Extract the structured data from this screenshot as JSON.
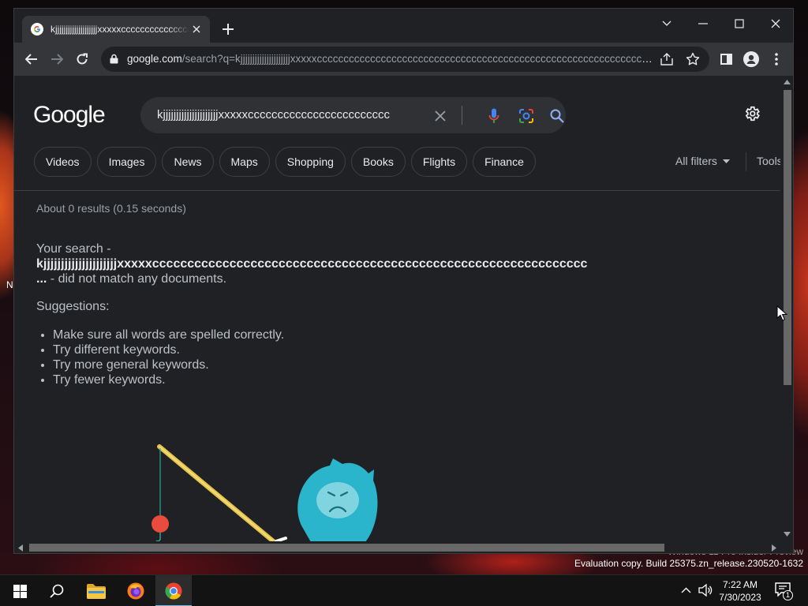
{
  "desktop": {
    "watermark_line1": "Windows 11 Pro Insider Preview",
    "watermark_line2": "Evaluation copy. Build 25375.zn_release.230520-1632",
    "edge_marks": [
      "N"
    ]
  },
  "browser": {
    "tab_title": "kjjjjjjjjjjjjjjjjjjjjxxxxxcccccccccccccccc",
    "address": {
      "host": "google.com",
      "path": "/search?q=kjjjjjjjjjjjjjjjjjjjjjxxxxxccccccccccccccccccccccccccccccccccccccccccccccccccccccccccccccccc..."
    }
  },
  "google": {
    "logo": "Google",
    "search_query": "kjjjjjjjjjjjjjjjjjjjjjxxxxxcccccccccccccccccccccccc",
    "chips": [
      "Videos",
      "Images",
      "News",
      "Maps",
      "Shopping",
      "Books",
      "Flights",
      "Finance"
    ],
    "all_filters": "All filters",
    "tools": "Tools",
    "result_stats": "About 0 results (0.15 seconds)",
    "no_match_prefix": "Your search -",
    "no_match_query": "kjjjjjjjjjjjjjjjjjjjjjxxxxxcccccccccccccccccccccccccccccccccccccccccccccccccccccccccccccc",
    "no_match_ellipsis": "...",
    "no_match_suffix": " - did not match any documents.",
    "suggestions_title": "Suggestions:",
    "suggestions": [
      "Make sure all words are spelled correctly.",
      "Try different keywords.",
      "Try more general keywords.",
      "Try fewer keywords."
    ]
  },
  "taskbar": {
    "time": "7:22 AM",
    "date": "7/30/2023",
    "notification_count": "1"
  },
  "colors": {
    "google_blue": "#4285f4",
    "google_red": "#ea4335",
    "google_yellow": "#fbbc05",
    "google_green": "#34a853",
    "mascot": "#2bb5cc"
  }
}
